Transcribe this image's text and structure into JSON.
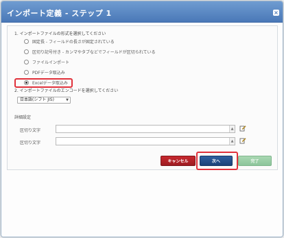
{
  "dialog": {
    "title": "インポート定義 - ステップ 1",
    "close_icon": "close-icon"
  },
  "q1": {
    "label": "1. インポートファイルの形式を選択してください",
    "options": [
      {
        "label": "固定長 - フィールドの長さが固定されている",
        "checked": false
      },
      {
        "label": "区切り記号付き - カンマやタブなどでフィールドが区切られている",
        "checked": false
      },
      {
        "label": "ファイルインポート",
        "checked": false
      },
      {
        "label": "PDFデータ取込み",
        "checked": false
      },
      {
        "label": "Excelデータ取込み",
        "checked": true
      }
    ]
  },
  "q2": {
    "label": "2. インポートファイルのエンコードを選択してください",
    "select_value": "日本語(シフト JIS)"
  },
  "details": {
    "section_label": "詳細設定",
    "fields": [
      {
        "label": "区切り文字",
        "value": ""
      },
      {
        "label": "区切り文字",
        "value": ""
      }
    ]
  },
  "buttons": {
    "cancel": "キャンセル",
    "next": "次へ",
    "done": "完了"
  },
  "colors": {
    "titlebar": "#4a78b7",
    "cancel": "#b0232a",
    "next": "#24508c",
    "done": "#9ccfa7",
    "highlight": "#e0303a"
  }
}
